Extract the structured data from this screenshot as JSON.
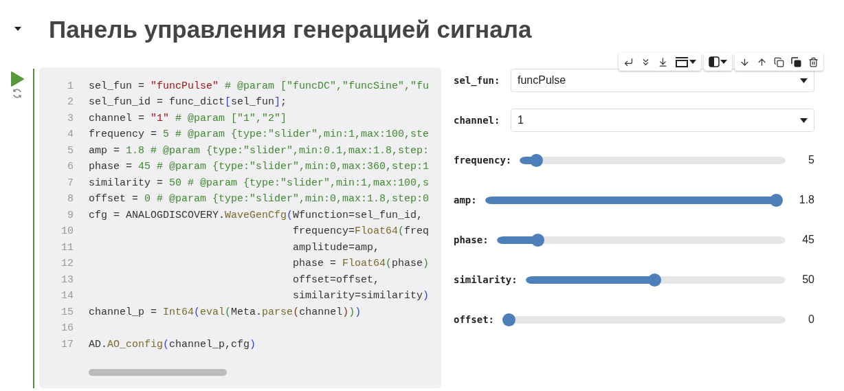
{
  "heading": {
    "text": "Панель управления генерацией сигнала",
    "expanded": true
  },
  "code": {
    "lines": [
      {
        "number": "1",
        "tokens": [
          {
            "kind": "plain",
            "text": "sel_fun = "
          },
          {
            "kind": "string",
            "text": "\"funcPulse\""
          },
          {
            "kind": "comment",
            "text": " # @param [\"funcDC\",\"funcSine\",\"fu"
          }
        ]
      },
      {
        "number": "2",
        "tokens": [
          {
            "kind": "plain",
            "text": "sel_fun_id = func_dict"
          },
          {
            "kind": "bracket1",
            "text": "["
          },
          {
            "kind": "plain",
            "text": "sel_fun"
          },
          {
            "kind": "bracket1",
            "text": "]"
          },
          {
            "kind": "plain",
            "text": ";"
          }
        ]
      },
      {
        "number": "3",
        "tokens": [
          {
            "kind": "plain",
            "text": "channel = "
          },
          {
            "kind": "string",
            "text": "\"1\""
          },
          {
            "kind": "comment",
            "text": " # @param [\"1\",\"2\"]"
          }
        ]
      },
      {
        "number": "4",
        "tokens": [
          {
            "kind": "plain",
            "text": "frequency = "
          },
          {
            "kind": "number",
            "text": "5"
          },
          {
            "kind": "comment",
            "text": " # @param {type:\"slider\",min:1,max:100,ste"
          }
        ]
      },
      {
        "number": "5",
        "tokens": [
          {
            "kind": "plain",
            "text": "amp = "
          },
          {
            "kind": "number",
            "text": "1.8"
          },
          {
            "kind": "comment",
            "text": " # @param {type:\"slider\",min:0.1,max:1.8,step:"
          }
        ]
      },
      {
        "number": "6",
        "tokens": [
          {
            "kind": "plain",
            "text": "phase = "
          },
          {
            "kind": "number",
            "text": "45"
          },
          {
            "kind": "comment",
            "text": " # @param {type:\"slider\",min:0,max:360,step:1"
          }
        ]
      },
      {
        "number": "7",
        "tokens": [
          {
            "kind": "plain",
            "text": "similarity = "
          },
          {
            "kind": "number",
            "text": "50"
          },
          {
            "kind": "comment",
            "text": " # @param {type:\"slider\",min:1,max:100,s"
          }
        ]
      },
      {
        "number": "8",
        "tokens": [
          {
            "kind": "plain",
            "text": "offset = "
          },
          {
            "kind": "number",
            "text": "0"
          },
          {
            "kind": "comment",
            "text": " # @param {type:\"slider\",min:0,max:1.8,step:0"
          }
        ]
      },
      {
        "number": "9",
        "tokens": [
          {
            "kind": "plain",
            "text": "cfg = ANALOGDISCOVERY."
          },
          {
            "kind": "func",
            "text": "WaveGenCfg"
          },
          {
            "kind": "bracket1",
            "text": "("
          },
          {
            "kind": "plain",
            "text": "Wfunction=sel_fun_id,"
          }
        ]
      },
      {
        "number": "10",
        "tokens": [
          {
            "kind": "plain",
            "text": "                                 frequency="
          },
          {
            "kind": "func",
            "text": "Float64"
          },
          {
            "kind": "bracket2",
            "text": "("
          },
          {
            "kind": "plain",
            "text": "freq"
          }
        ]
      },
      {
        "number": "11",
        "tokens": [
          {
            "kind": "plain",
            "text": "                                 amplitude=amp,"
          }
        ]
      },
      {
        "number": "12",
        "tokens": [
          {
            "kind": "plain",
            "text": "                                 phase = "
          },
          {
            "kind": "func",
            "text": "Float64"
          },
          {
            "kind": "bracket2",
            "text": "("
          },
          {
            "kind": "plain",
            "text": "phase"
          },
          {
            "kind": "bracket2",
            "text": ")"
          }
        ]
      },
      {
        "number": "13",
        "tokens": [
          {
            "kind": "plain",
            "text": "                                 offset=offset,"
          }
        ]
      },
      {
        "number": "14",
        "tokens": [
          {
            "kind": "plain",
            "text": "                                 similarity=similarity"
          },
          {
            "kind": "bracket1",
            "text": ")"
          }
        ]
      },
      {
        "number": "15",
        "tokens": [
          {
            "kind": "plain",
            "text": "channel_p = "
          },
          {
            "kind": "func",
            "text": "Int64"
          },
          {
            "kind": "bracket1",
            "text": "("
          },
          {
            "kind": "func",
            "text": "eval"
          },
          {
            "kind": "bracket2",
            "text": "("
          },
          {
            "kind": "plain",
            "text": "Meta."
          },
          {
            "kind": "func",
            "text": "parse"
          },
          {
            "kind": "bracket3",
            "text": "("
          },
          {
            "kind": "plain",
            "text": "channel"
          },
          {
            "kind": "bracket3",
            "text": ")"
          },
          {
            "kind": "bracket2",
            "text": ")"
          },
          {
            "kind": "bracket1",
            "text": ")"
          }
        ]
      },
      {
        "number": "16"
      },
      {
        "number": "17",
        "tokens": [
          {
            "kind": "plain",
            "text": "AD."
          },
          {
            "kind": "func",
            "text": "AO_config"
          },
          {
            "kind": "bracket1",
            "text": "("
          },
          {
            "kind": "plain",
            "text": "channel_p,cfg"
          },
          {
            "kind": "bracket1",
            "text": ")"
          }
        ]
      }
    ]
  },
  "form": [
    {
      "kind": "dropdown",
      "label": "sel_fun:",
      "value": "funcPulse"
    },
    {
      "kind": "dropdown",
      "label": "channel:",
      "value": "1"
    },
    {
      "kind": "slider",
      "label": "frequency:",
      "level": 0.04,
      "reading": "5"
    },
    {
      "kind": "slider",
      "label": "amp:",
      "level": 1,
      "reading": "1.8"
    },
    {
      "kind": "slider",
      "label": "phase:",
      "level": 0.125,
      "reading": "45"
    },
    {
      "kind": "slider",
      "label": "similarity:",
      "level": 0.495,
      "reading": "50"
    },
    {
      "kind": "slider",
      "label": "offset:",
      "level": 0,
      "reading": "0"
    }
  ]
}
